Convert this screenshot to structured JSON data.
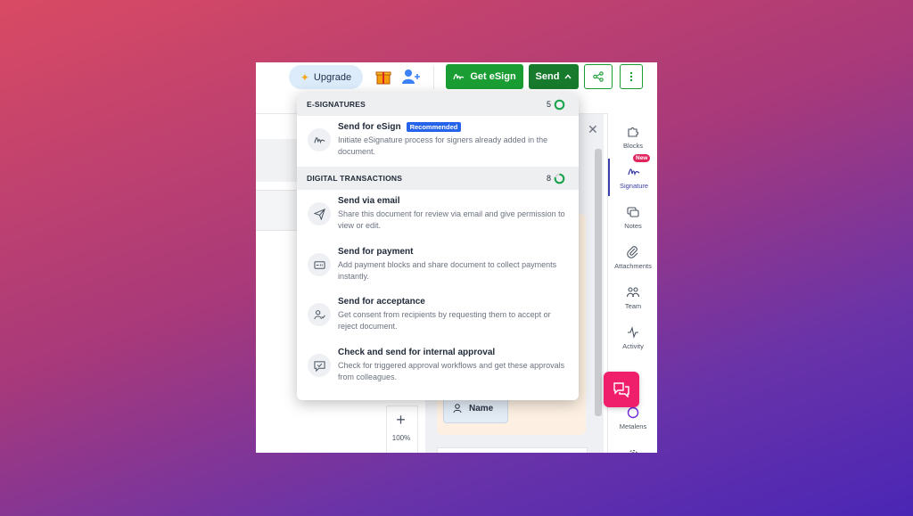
{
  "topbar": {
    "upgrade_label": "Upgrade",
    "get_esign_label": "Get eSign",
    "send_label": "Send"
  },
  "canvas": {
    "name_field_label": "Name",
    "zoom_level": "100%"
  },
  "sidebar": {
    "new_badge": "New",
    "items": [
      {
        "label": "Blocks",
        "icon": "puzzle-icon"
      },
      {
        "label": "Signature",
        "icon": "signature-icon"
      },
      {
        "label": "Notes",
        "icon": "notes-icon"
      },
      {
        "label": "Attachments",
        "icon": "paperclip-icon"
      },
      {
        "label": "Team",
        "icon": "team-icon"
      },
      {
        "label": "Activity",
        "icon": "activity-icon"
      },
      {
        "label": "Metalens",
        "icon": "metalens-icon"
      }
    ]
  },
  "menu": {
    "esign_section": {
      "title": "E-SIGNATURES",
      "count": "5"
    },
    "send_for_esign": {
      "title": "Send for eSign",
      "badge": "Recommended",
      "desc": "Initiate eSignature process for signers already added in the document."
    },
    "digital_section": {
      "title": "DIGITAL TRANSACTIONS",
      "count": "8"
    },
    "items": [
      {
        "title": "Send via email",
        "desc": "Share this document for review via email and give permission to view or edit."
      },
      {
        "title": "Send for payment",
        "desc": "Add payment blocks and share document to collect payments instantly."
      },
      {
        "title": "Send for acceptance",
        "desc": "Get consent from recipients by requesting them to accept or reject document."
      },
      {
        "title": "Check and send for internal approval",
        "desc": "Check for triggered approval workflows and get these approvals from colleagues."
      }
    ]
  },
  "colors": {
    "primary_green": "#1a9e33",
    "send_green": "#177a2c",
    "recommended_blue": "#2563eb",
    "fab_pink": "#ef1f6c"
  }
}
